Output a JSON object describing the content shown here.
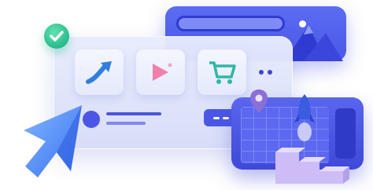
{
  "colors": {
    "accent": "#4a57e6",
    "accent_dark": "#2f3bd0",
    "card_light": "#e5e9fb",
    "check_green": "#22b487",
    "pin_purple": "#8b6fd6",
    "play_pink": "#f07fae",
    "cart_teal": "#2fb7a6",
    "stairs_lavender": "#cdbcf5"
  },
  "icons": {
    "check": "check-icon",
    "trend": "trend-arrow-icon",
    "play": "play-icon",
    "cart": "shopping-cart-icon",
    "pin": "location-pin-icon",
    "cursor": "mouse-cursor-icon",
    "rocket": "rocket-icon",
    "mountain": "mountain-icon"
  }
}
